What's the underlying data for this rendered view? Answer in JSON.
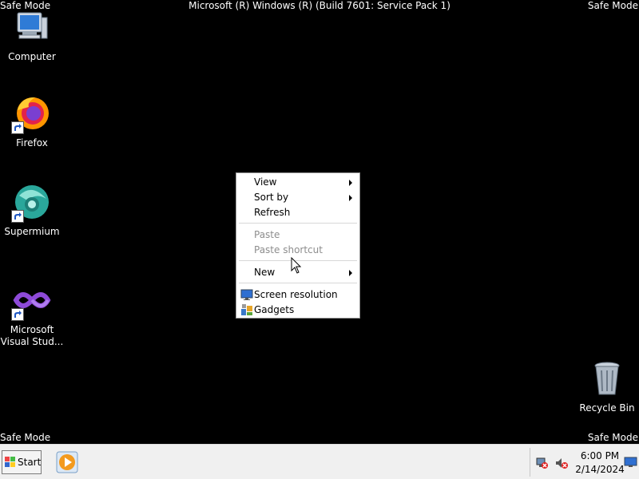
{
  "overlay": {
    "safe_mode": "Safe Mode",
    "banner": "Microsoft (R) Windows (R) (Build 7601: Service Pack 1)"
  },
  "desktop": {
    "icons": [
      {
        "label": "Computer",
        "icon": "computer-icon"
      },
      {
        "label": "Firefox",
        "icon": "firefox-icon"
      },
      {
        "label": "Supermium",
        "icon": "supermium-icon"
      },
      {
        "label": "Microsoft Visual Stud...",
        "label_line1": "Microsoft",
        "label_line2": "Visual Stud...",
        "icon": "visual-studio-icon"
      },
      {
        "label": "Recycle Bin",
        "icon": "recycle-bin-icon"
      }
    ]
  },
  "context_menu": {
    "items": [
      {
        "label": "View",
        "submenu": true,
        "enabled": true
      },
      {
        "label": "Sort by",
        "submenu": true,
        "enabled": true
      },
      {
        "label": "Refresh",
        "submenu": false,
        "enabled": true
      },
      {
        "label": "Paste",
        "submenu": false,
        "enabled": false
      },
      {
        "label": "Paste shortcut",
        "submenu": false,
        "enabled": false
      },
      {
        "label": "New",
        "submenu": true,
        "enabled": true
      },
      {
        "label": "Screen resolution",
        "submenu": false,
        "enabled": true,
        "icon": "screen-resolution-icon"
      },
      {
        "label": "Gadgets",
        "submenu": false,
        "enabled": true,
        "icon": "gadgets-icon"
      }
    ]
  },
  "taskbar": {
    "start_label": "Start",
    "pinned": [
      {
        "icon": "media-player-icon"
      }
    ],
    "tray": {
      "icons": [
        "network-error-icon",
        "volume-muted-icon"
      ],
      "time": "6:00 PM",
      "date": "2/14/2024",
      "show_desktop_icon": "show-desktop-icon"
    }
  },
  "colors": {
    "desktop_bg": "#000000",
    "menu_bg": "#ffffff",
    "menu_disabled": "#8d8d8d",
    "taskbar_bg": "#f0f0f0"
  }
}
